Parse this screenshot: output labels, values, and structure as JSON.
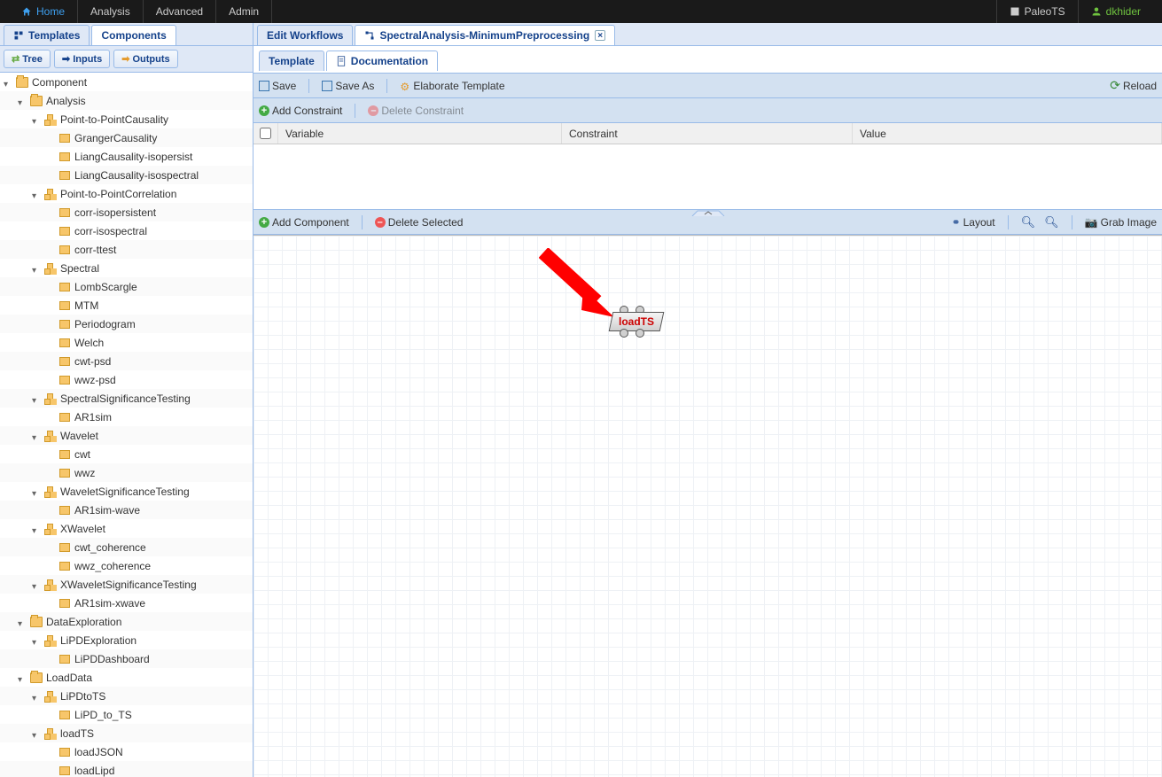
{
  "topnav": {
    "home": "Home",
    "analysis": "Analysis",
    "advanced": "Advanced",
    "admin": "Admin",
    "app": "PaleoTS",
    "user": "dkhider"
  },
  "left": {
    "tabs": {
      "templates": "Templates",
      "components": "Components"
    },
    "buttons": {
      "tree": "Tree",
      "inputs": "Inputs",
      "outputs": "Outputs"
    },
    "tree": {
      "root": "Component",
      "Analysis": "Analysis",
      "PointToPointCausality": "Point-to-PointCausality",
      "GrangerCausality": "GrangerCausality",
      "LiangCausalityIsopersist": "LiangCausality-isopersist",
      "LiangCausalityIsospectral": "LiangCausality-isospectral",
      "PointToPointCorrelation": "Point-to-PointCorrelation",
      "corrIsopersistent": "corr-isopersistent",
      "corrIsospectral": "corr-isospectral",
      "corrTtest": "corr-ttest",
      "Spectral": "Spectral",
      "LombScargle": "LombScargle",
      "MTM": "MTM",
      "Periodogram": "Periodogram",
      "Welch": "Welch",
      "cwtPsd": "cwt-psd",
      "wwzPsd": "wwz-psd",
      "SpectralSignificanceTesting": "SpectralSignificanceTesting",
      "AR1sim": "AR1sim",
      "Wavelet": "Wavelet",
      "cwt": "cwt",
      "wwz": "wwz",
      "WaveletSignificanceTesting": "WaveletSignificanceTesting",
      "AR1simWave": "AR1sim-wave",
      "XWavelet": "XWavelet",
      "cwtCoherence": "cwt_coherence",
      "wwzCoherence": "wwz_coherence",
      "XWaveletSignificanceTesting": "XWaveletSignificanceTesting",
      "AR1simXwave": "AR1sim-xwave",
      "DataExploration": "DataExploration",
      "LiPDExploration": "LiPDExploration",
      "LiPDDashboard": "LiPDDashboard",
      "LoadData": "LoadData",
      "LiPDtoTS": "LiPDtoTS",
      "LiPD_to_TS": "LiPD_to_TS",
      "loadTS": "loadTS",
      "loadJSON": "loadJSON",
      "loadLipd": "loadLipd"
    }
  },
  "right": {
    "tabs": {
      "edit": "Edit Workflows",
      "wf": "SpectralAnalysis-MinimumPreprocessing"
    },
    "subtabs": {
      "template": "Template",
      "doc": "Documentation"
    },
    "toolbar": {
      "save": "Save",
      "saveas": "Save As",
      "elaborate": "Elaborate Template",
      "reload": "Reload"
    },
    "constraints": {
      "add": "Add Constraint",
      "del": "Delete Constraint",
      "cols": {
        "variable": "Variable",
        "constraint": "Constraint",
        "value": "Value"
      }
    },
    "canvas": {
      "add": "Add Component",
      "del": "Delete Selected",
      "layout": "Layout",
      "grab": "Grab Image",
      "node": "loadTS"
    }
  }
}
